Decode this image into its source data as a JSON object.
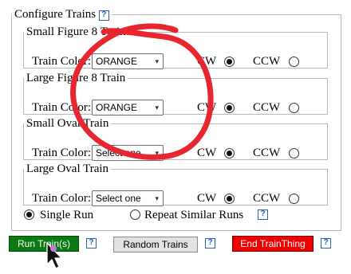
{
  "title": "Configure Trains",
  "help_glyph": "?",
  "dropdown_glyph": "▾",
  "train_color_label": "Train Color:",
  "direction_cw": "CW",
  "direction_ccw": "CCW",
  "trains": [
    {
      "name": "Small Figure 8 Train",
      "color_value": "ORANGE",
      "direction": "CW"
    },
    {
      "name": "Large Figure 8 Train",
      "color_value": "ORANGE",
      "direction": "CW"
    },
    {
      "name": "Small Oval Train",
      "color_value": "Select one",
      "direction": "CW"
    },
    {
      "name": "Large Oval Train",
      "color_value": "Select one",
      "direction": "CW"
    }
  ],
  "run_mode": {
    "single_label": "Single Run",
    "repeat_label": "Repeat Similar Runs",
    "selected": "single"
  },
  "buttons": {
    "run": "Run Train(s)",
    "random": "Random Trains",
    "end": "End TrainThing"
  },
  "colors": {
    "run_bg": "#0b7a12",
    "end_bg": "#f00000",
    "annotation": "#e8262f",
    "help": "#2a5fb8"
  }
}
